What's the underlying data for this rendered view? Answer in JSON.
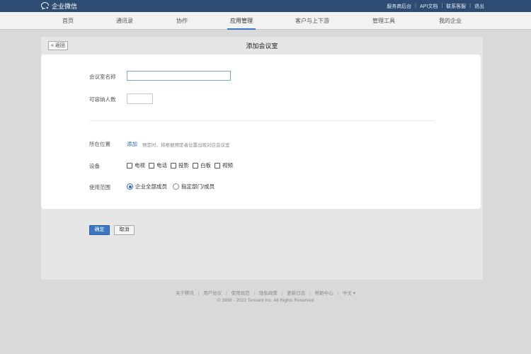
{
  "brand": {
    "name": "企业微信"
  },
  "top_links": [
    "服务商后台",
    "API文档",
    "联系客服",
    "退出"
  ],
  "nav": [
    {
      "label": "首页"
    },
    {
      "label": "通讯录"
    },
    {
      "label": "协作"
    },
    {
      "label": "应用管理",
      "active": true
    },
    {
      "label": "客户与上下游"
    },
    {
      "label": "管理工具"
    },
    {
      "label": "我的企业"
    }
  ],
  "page": {
    "back_label": "« 返回",
    "title": "添加会议室"
  },
  "form": {
    "name_label": "会议室名称",
    "name_value": "",
    "capacity_label": "可容纳人数",
    "capacity_value": "",
    "location_label": "所在位置",
    "location_add": "添加",
    "location_hint": "预定时，将根据预定者位置出现对应会议室",
    "equipment_label": "设备",
    "equipment": [
      {
        "label": "电视",
        "checked": false
      },
      {
        "label": "电话",
        "checked": false
      },
      {
        "label": "投影",
        "checked": false
      },
      {
        "label": "白板",
        "checked": false
      },
      {
        "label": "视频",
        "checked": false
      }
    ],
    "scope_label": "使用范围",
    "scope_options": [
      {
        "label": "企业全部成员",
        "selected": true
      },
      {
        "label": "指定部门/成员",
        "selected": false
      }
    ]
  },
  "actions": {
    "confirm": "确定",
    "cancel": "取消"
  },
  "footer": {
    "links": [
      "关于腾讯",
      "用户协议",
      "使用规范",
      "隐私政策",
      "更新日志",
      "帮助中心",
      "中文 ▾"
    ],
    "copyright": "© 1998 - 2022 Tencent Inc. All Rights Reserved"
  },
  "colors": {
    "topbar": "#2e4b74",
    "accent": "#3d76c2",
    "link": "#2f6bb5"
  }
}
